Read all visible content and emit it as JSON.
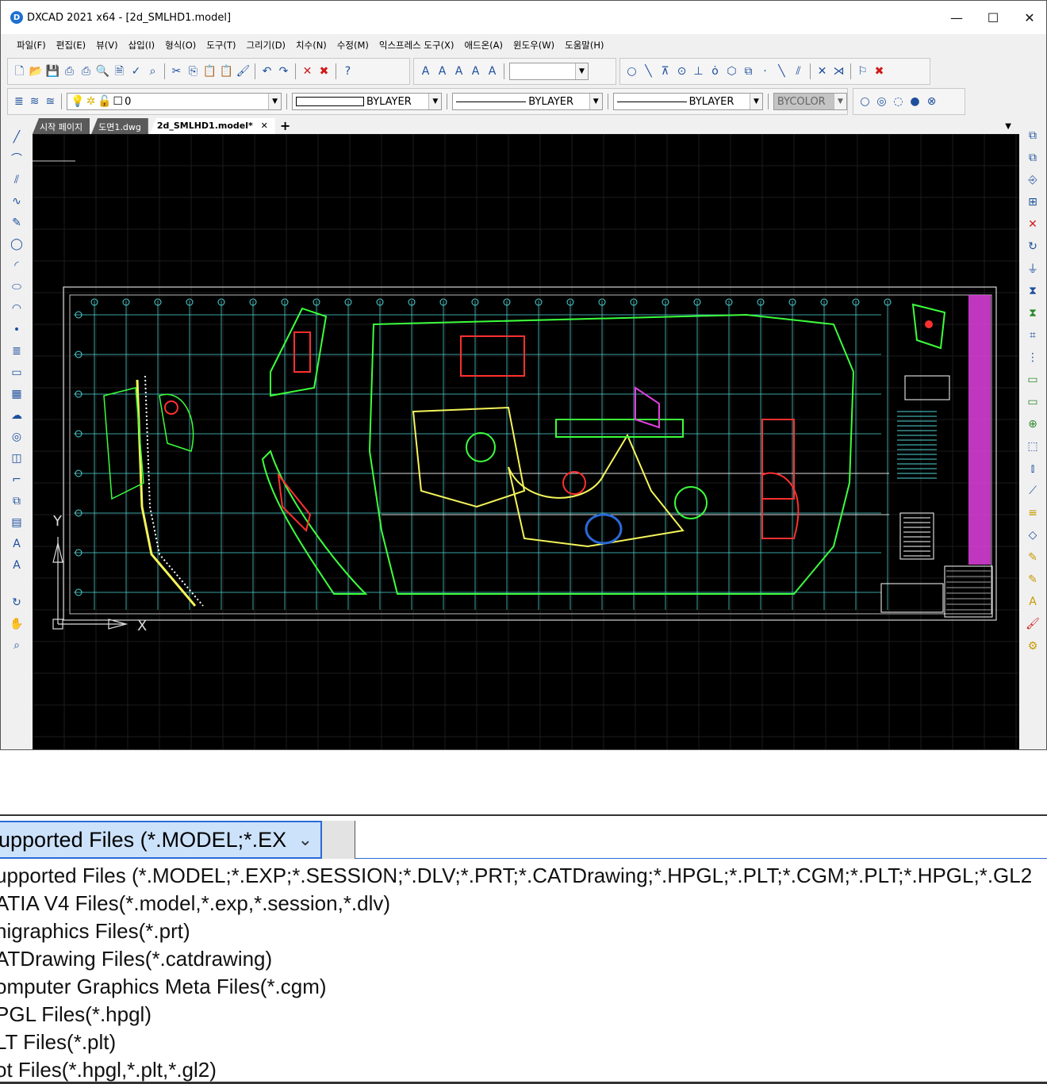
{
  "window": {
    "app_icon": "dxcad-logo-icon",
    "title": "DXCAD 2021 x64   - [2d_SMLHD1.model]",
    "minimize": "—",
    "maximize": "☐",
    "close": "✕"
  },
  "menu": [
    "파일(F)",
    "편집(E)",
    "뷰(V)",
    "삽입(I)",
    "형식(O)",
    "도구(T)",
    "그리기(D)",
    "치수(N)",
    "수정(M)",
    "익스프레스 도구(X)",
    "애드온(A)",
    "윈도우(W)",
    "도움말(H)"
  ],
  "properties_toolbar": {
    "layer_value": "0",
    "color_value": "BYLAYER",
    "linetype_value": "BYLAYER",
    "lineweight_value": "BYLAYER",
    "plotstyle_value": "BYCOLOR"
  },
  "tabs": [
    {
      "label": "시작 페이지",
      "active": false
    },
    {
      "label": "도면1.dwg",
      "active": false
    },
    {
      "label": "2d_SMLHD1.model*",
      "active": true
    }
  ],
  "tab_close": "✕",
  "tab_add": "+",
  "tab_menu": "▼",
  "ucs": {
    "x_label": "X",
    "y_label": "Y"
  },
  "colors": {
    "canvas_bg": "#000000",
    "grid": "#1c1c1c",
    "frame": "#ffffff",
    "drawing_green": "#3cff3c",
    "drawing_yellow": "#f4f45a",
    "drawing_cyan": "#4fd6d6",
    "drawing_red": "#ff3030",
    "drawing_magenta": "#e040e0",
    "selection_blue": "#2a6ad8"
  },
  "file_type": {
    "selected": "upported Files (*.MODEL;*.EX",
    "options": [
      "upported Files (*.MODEL;*.EXP;*.SESSION;*.DLV;*.PRT;*.CATDrawing;*.HPGL;*.PLT;*.CGM;*.PLT;*.HPGL;*.GL2",
      "ATIA V4 Files(*.model,*.exp,*.session,*.dlv)",
      "nigraphics Files(*.prt)",
      "ATDrawing Files(*.catdrawing)",
      "omputer Graphics Meta Files(*.cgm)",
      "PGL Files(*.hpgl)",
      "LT Files(*.plt)",
      "ot Files(*.hpgl,*.plt,*.gl2)"
    ]
  }
}
